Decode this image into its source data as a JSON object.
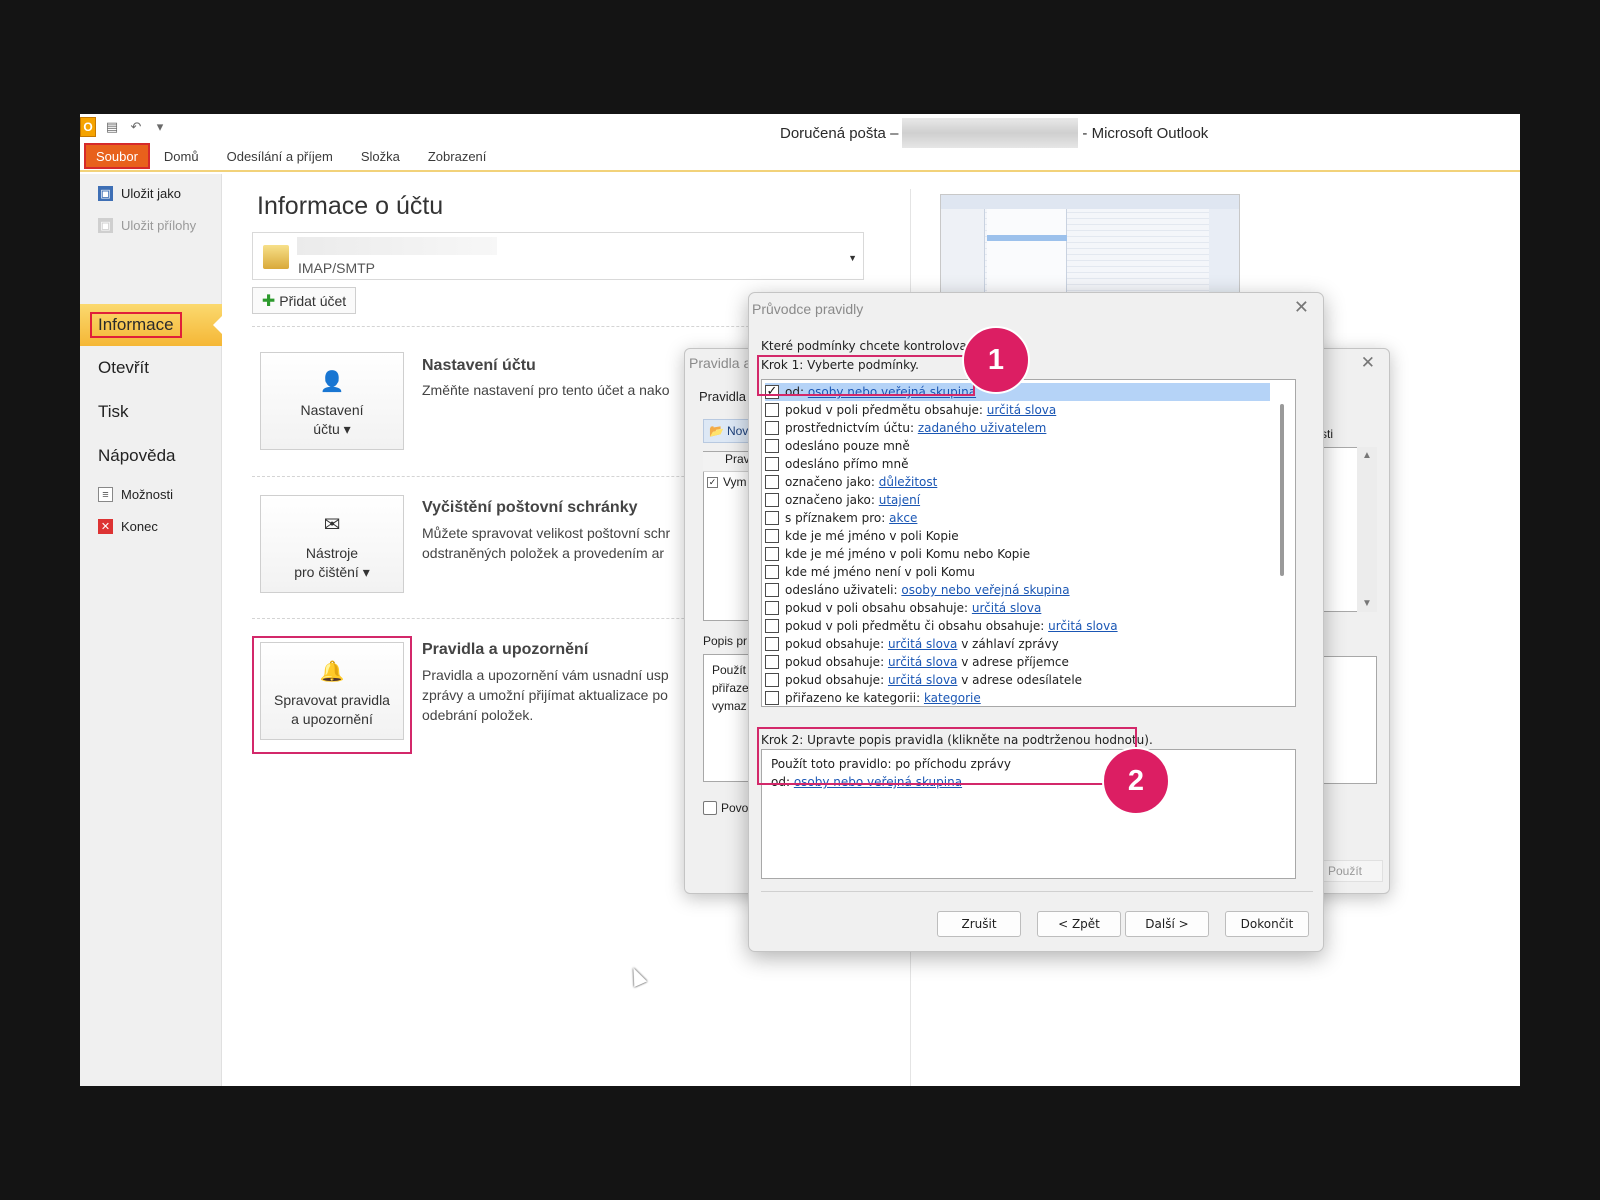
{
  "window": {
    "title_prefix": "Doručená pošta –",
    "title_suffix": "- Microsoft Outlook"
  },
  "qat": {
    "app_icon": "O"
  },
  "ribbon": {
    "tabs": [
      "Soubor",
      "Domů",
      "Odesílání a příjem",
      "Složka",
      "Zobrazení"
    ]
  },
  "sidebar": {
    "save_as": "Uložit jako",
    "save_attachments": "Uložit přílohy",
    "info": "Informace",
    "open": "Otevřít",
    "print": "Tisk",
    "help": "Nápověda",
    "options": "Možnosti",
    "exit": "Konec"
  },
  "main": {
    "title": "Informace o účtu",
    "account_type": "IMAP/SMTP",
    "add_account": "Přidat účet",
    "sections": [
      {
        "button_line1": "Nastavení",
        "button_line2": "účtu ▾",
        "title": "Nastavení účtu",
        "desc_lines": [
          "Změňte nastavení pro tento účet a nako"
        ]
      },
      {
        "button_line1": "Nástroje",
        "button_line2": "pro čištění ▾",
        "title": "Vyčištění poštovní schránky",
        "desc_lines": [
          "Můžete spravovat velikost poštovní schr",
          "odstraněných položek a provedením ar"
        ]
      },
      {
        "button_line1": "Spravovat pravidla",
        "button_line2": "a upozornění",
        "title": "Pravidla a upozornění",
        "desc_lines": [
          "Pravidla a upozornění vám usnadní usp",
          "zprávy a umožní přijímat aktualizace po",
          "odebrání položek."
        ]
      }
    ]
  },
  "rules_dialog": {
    "title": "Pravidla a",
    "tab": "Pravidla",
    "new_button": "Nov",
    "list_header": "Prav",
    "list_row": "Vym",
    "list_row_checked": "✓",
    "desc_label": "Popis pr",
    "desc_lines": [
      "Použít",
      "přiřaze",
      "vymaz"
    ],
    "enable": "Povo",
    "right_note": "sti",
    "apply": "Použít"
  },
  "wizard": {
    "title": "Průvodce pravidly",
    "question": "Které podmínky chcete kontrolovat?",
    "step1": "Krok 1: Vyberte podmínky.",
    "conditions": [
      {
        "text": "od: ",
        "link": "osoby nebo veřejná skupina",
        "after": "",
        "checked": true
      },
      {
        "text": "pokud v poli předmětu obsahuje: ",
        "link": "určitá slova",
        "after": "",
        "checked": false
      },
      {
        "text": "prostřednictvím účtu: ",
        "link": "zadaného uživatelem",
        "after": "",
        "checked": false
      },
      {
        "text": "odesláno pouze mně",
        "link": "",
        "after": "",
        "checked": false
      },
      {
        "text": "odesláno přímo mně",
        "link": "",
        "after": "",
        "checked": false
      },
      {
        "text": "označeno jako: ",
        "link": "důležitost",
        "after": "",
        "checked": false
      },
      {
        "text": "označeno jako: ",
        "link": "utajení",
        "after": "",
        "checked": false
      },
      {
        "text": "s příznakem pro: ",
        "link": "akce",
        "after": "",
        "checked": false
      },
      {
        "text": "kde je mé jméno v poli Kopie",
        "link": "",
        "after": "",
        "checked": false
      },
      {
        "text": "kde je mé jméno v poli Komu nebo Kopie",
        "link": "",
        "after": "",
        "checked": false
      },
      {
        "text": "kde mé jméno není v poli Komu",
        "link": "",
        "after": "",
        "checked": false
      },
      {
        "text": "odesláno uživateli: ",
        "link": "osoby nebo veřejná skupina",
        "after": "",
        "checked": false
      },
      {
        "text": "pokud v poli obsahu obsahuje: ",
        "link": "určitá slova",
        "after": "",
        "checked": false
      },
      {
        "text": "pokud v poli předmětu či obsahu obsahuje: ",
        "link": "určitá slova",
        "after": "",
        "checked": false
      },
      {
        "text": "pokud obsahuje: ",
        "link": "určitá slova",
        "after": " v záhlaví zprávy",
        "checked": false
      },
      {
        "text": "pokud obsahuje: ",
        "link": "určitá slova",
        "after": " v adrese příjemce",
        "checked": false
      },
      {
        "text": "pokud obsahuje: ",
        "link": "určitá slova",
        "after": " v adrese odesílatele",
        "checked": false
      },
      {
        "text": "přiřazeno ke kategorii: ",
        "link": "kategorie",
        "after": "",
        "checked": false
      }
    ],
    "check_mark": "✓",
    "step2": "Krok 2: Upravte popis pravidla (klikněte na podtrženou hodnotu).",
    "desc_line1": "Použít toto pravidlo: po příchodu zprávy",
    "desc_line2_prefix": "od: ",
    "desc_line2_link": "osoby nebo veřejná skupina",
    "buttons": {
      "cancel": "Zrušit",
      "back": "< Zpět",
      "next": "Další >",
      "finish": "Dokončit"
    }
  },
  "badges": {
    "one": "1",
    "two": "2"
  },
  "colors": {
    "accent": "#dc1e63",
    "highlight": "#d3286a",
    "selection": "#b5d3f7",
    "file_tab": "#e8611c",
    "link": "#1a56b4"
  }
}
